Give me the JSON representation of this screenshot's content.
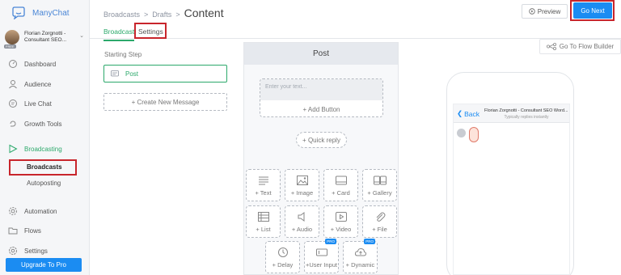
{
  "app": {
    "name": "ManyChat"
  },
  "account": {
    "name_line1": "Florian Zorgnotti -",
    "name_line2": "Consultant SEO...",
    "plan_badge": "FREE"
  },
  "sidebar": {
    "items": [
      {
        "label": "Dashboard",
        "icon": "dashboard-icon"
      },
      {
        "label": "Audience",
        "icon": "user-icon"
      },
      {
        "label": "Live Chat",
        "icon": "chat-icon"
      },
      {
        "label": "Growth Tools",
        "icon": "growth-icon"
      },
      {
        "label": "Broadcasting",
        "icon": "send-icon"
      },
      {
        "label": "Automation",
        "icon": "gear-icon"
      },
      {
        "label": "Flows",
        "icon": "folder-icon"
      },
      {
        "label": "Settings",
        "icon": "settings-icon"
      }
    ],
    "subitems": [
      {
        "label": "Broadcasts"
      },
      {
        "label": "Autoposting"
      }
    ],
    "upgrade_label": "Upgrade To Pro"
  },
  "header": {
    "breadcrumb": [
      "Broadcasts",
      "Drafts"
    ],
    "separator": ">",
    "title": "Content",
    "preview_label": "Preview",
    "go_next_label": "Go Next"
  },
  "tabs": [
    {
      "label": "Broadcast",
      "active": true
    },
    {
      "label": "Settings",
      "active": false
    }
  ],
  "steps": {
    "starting_label": "Starting Step",
    "first_step": "Post",
    "create_label": "+ Create New Message"
  },
  "editor": {
    "title": "Post",
    "text_placeholder": "Enter your text...",
    "add_button": "+ Add Button",
    "quick_reply": "+ Quick reply",
    "blocks": [
      {
        "label": "+ Text",
        "icon": "text-icon"
      },
      {
        "label": "+ Image",
        "icon": "image-icon"
      },
      {
        "label": "+ Card",
        "icon": "card-icon"
      },
      {
        "label": "+ Gallery",
        "icon": "gallery-icon"
      },
      {
        "label": "+ List",
        "icon": "list-icon"
      },
      {
        "label": "+ Audio",
        "icon": "audio-icon"
      },
      {
        "label": "+ Video",
        "icon": "video-icon"
      },
      {
        "label": "+ File",
        "icon": "file-icon"
      },
      {
        "label": "+ Delay",
        "icon": "clock-icon"
      },
      {
        "label": "+User Input",
        "icon": "input-icon",
        "badge": "PRO"
      },
      {
        "label": "+ Dynamic",
        "icon": "cloud-icon",
        "badge": "PRO"
      }
    ]
  },
  "preview": {
    "flow_builder_label": "Go To Flow Builder",
    "back_label": "Back",
    "page_name": "Florian Zorgnotti - Consultant SEO Word...",
    "reply_status": "Typically replies instantly"
  },
  "colors": {
    "accent_green": "#2ca96b",
    "primary_blue": "#1b8cf2",
    "highlight_red": "#c8252c"
  }
}
